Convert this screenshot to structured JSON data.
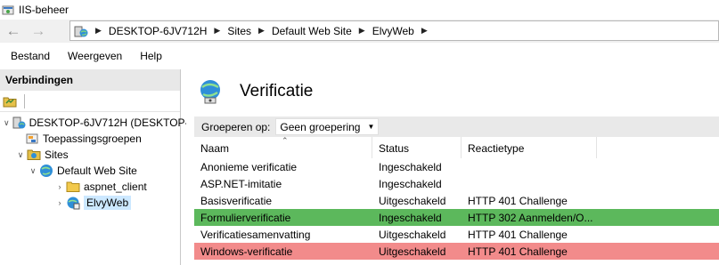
{
  "window": {
    "title": "IIS-beheer",
    "icon": "iis-app-icon"
  },
  "nav": {
    "back_icon": "arrow-left-icon",
    "forward_icon": "arrow-right-icon",
    "breadcrumb": [
      "DESKTOP-6JV712H",
      "Sites",
      "Default Web Site",
      "ElvyWeb"
    ]
  },
  "menu": [
    "Bestand",
    "Weergeven",
    "Help"
  ],
  "connections": {
    "header": "Verbindingen",
    "tree": [
      {
        "label": "DESKTOP-6JV712H (DESKTOP-",
        "icon": "server-icon",
        "toggle": "expanded",
        "level": 0
      },
      {
        "label": "Toepassingsgroepen",
        "icon": "app-pools-icon",
        "toggle": "none",
        "level": 1
      },
      {
        "label": "Sites",
        "icon": "sites-folder-icon",
        "toggle": "expanded",
        "level": 1
      },
      {
        "label": "Default Web Site",
        "icon": "globe-icon",
        "toggle": "expanded",
        "level": 2
      },
      {
        "label": "aspnet_client",
        "icon": "folder-icon",
        "toggle": "collapsed",
        "level": 3
      },
      {
        "label": "ElvyWeb",
        "icon": "web-app-icon",
        "toggle": "collapsed",
        "level": 3,
        "selected": true
      }
    ]
  },
  "main": {
    "title": "Verificatie",
    "group_label": "Groeperen op:",
    "group_value": "Geen groepering",
    "columns": [
      "Naam",
      "Status",
      "Reactietype"
    ],
    "rows": [
      {
        "name": "Anonieme verificatie",
        "status": "Ingeschakeld",
        "response": "",
        "highlight": "none"
      },
      {
        "name": "ASP.NET-imitatie",
        "status": "Ingeschakeld",
        "response": "",
        "highlight": "none"
      },
      {
        "name": "Basisverificatie",
        "status": "Uitgeschakeld",
        "response": "HTTP 401 Challenge",
        "highlight": "none"
      },
      {
        "name": "Formulierverificatie",
        "status": "Ingeschakeld",
        "response": "HTTP 302 Aanmelden/O...",
        "highlight": "green"
      },
      {
        "name": "Verificatiesamenvatting",
        "status": "Uitgeschakeld",
        "response": "HTTP 401 Challenge",
        "highlight": "none"
      },
      {
        "name": "Windows-verificatie",
        "status": "Uitgeschakeld",
        "response": "HTTP 401 Challenge",
        "highlight": "red"
      }
    ]
  },
  "colors": {
    "green_highlight": "#5cb85c",
    "red_highlight": "#f28b8b",
    "selection": "#cce8ff"
  }
}
